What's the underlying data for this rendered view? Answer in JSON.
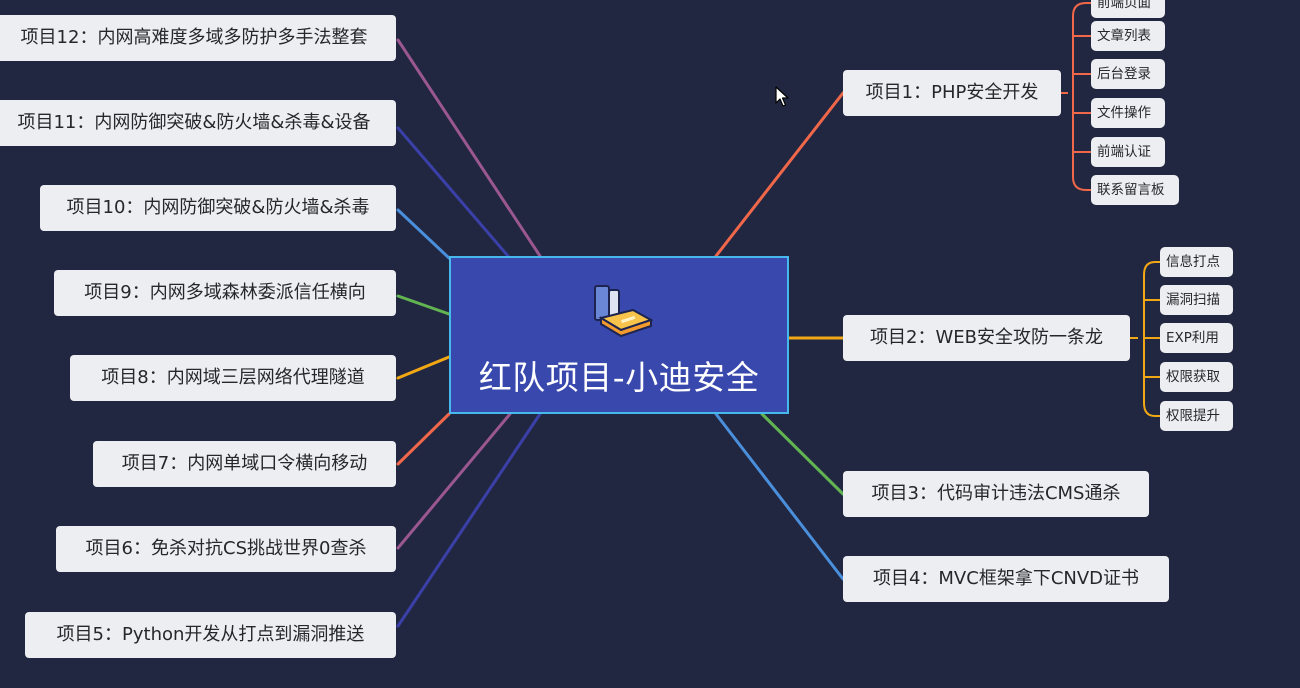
{
  "diagram": {
    "center": {
      "title": "红队项目-小迪安全",
      "icon": "books-icon"
    },
    "left_nodes": [
      {
        "label": "项目12：内网高难度多域多防护多手法整套",
        "color": "#9a5790"
      },
      {
        "label": "项目11：内网防御突破&防火墙&杀毒&设备",
        "color": "#3a40a8"
      },
      {
        "label": "项目10：内网防御突破&防火墙&杀毒",
        "color": "#4a8fdc"
      },
      {
        "label": "项目9：内网多域森林委派信任横向",
        "color": "#62b452"
      },
      {
        "label": "项目8：内网域三层网络代理隧道",
        "color": "#f2a815"
      },
      {
        "label": "项目7：内网单域口令横向移动",
        "color": "#f0674a"
      },
      {
        "label": "项目6：免杀对抗CS挑战世界0查杀",
        "color": "#9a5790"
      },
      {
        "label": "项目5：Python开发从打点到漏洞推送",
        "color": "#3a40a8"
      }
    ],
    "right_nodes": [
      {
        "label": "项目1：PHP安全开发",
        "color": "#f0674a",
        "children": [
          "前端页面",
          "文章列表",
          "后台登录",
          "文件操作",
          "前端认证",
          "联系留言板"
        ]
      },
      {
        "label": "项目2：WEB安全攻防一条龙",
        "color": "#f2a815",
        "children": [
          "信息打点",
          "漏洞扫描",
          "EXP利用",
          "权限获取",
          "权限提升"
        ]
      },
      {
        "label": "项目3：代码审计违法CMS通杀",
        "color": "#62b452",
        "children": []
      },
      {
        "label": "项目4：MVC框架拿下CNVD证书",
        "color": "#4a8fdc",
        "children": []
      }
    ]
  }
}
